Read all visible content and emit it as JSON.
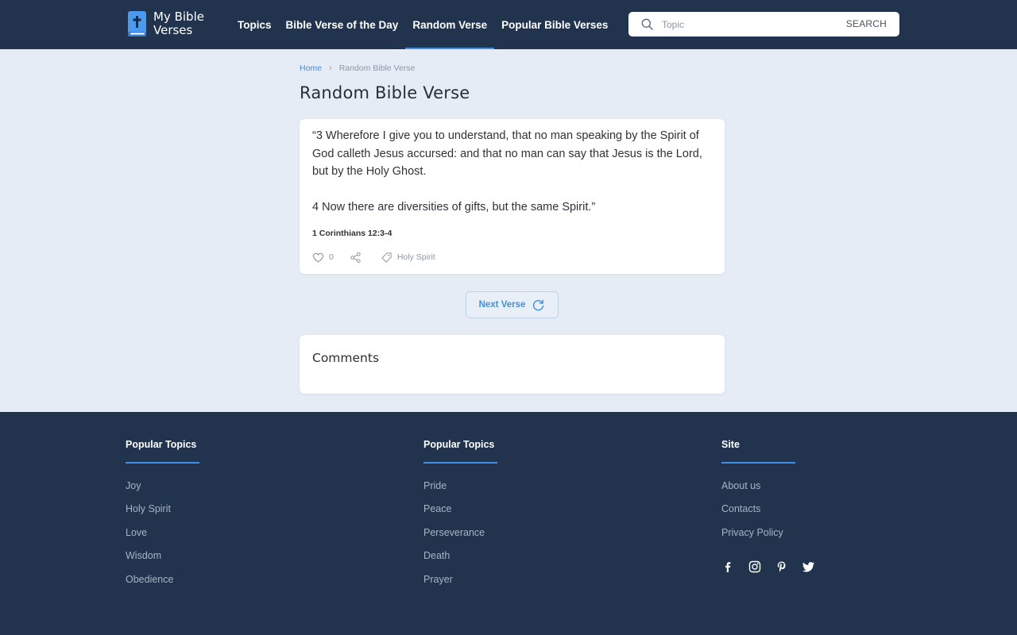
{
  "header": {
    "logo_line1": "My Bible",
    "logo_line2": "Verses",
    "nav": [
      {
        "label": "Topics",
        "active": false
      },
      {
        "label": "Bible Verse of the Day",
        "active": false
      },
      {
        "label": "Random Verse",
        "active": true
      },
      {
        "label": "Popular Bible Verses",
        "active": false
      }
    ],
    "search": {
      "placeholder": "Topic",
      "value": "",
      "button_label": "SEARCH"
    }
  },
  "breadcrumb": {
    "home": "Home",
    "separator": "›",
    "current": "Random Bible Verse"
  },
  "page_title": "Random Bible Verse",
  "verse": {
    "paragraph1": "“3 Wherefore I give you to understand, that no man speaking by the Spirit of God calleth Jesus accursed: and that no man can say that Jesus is the Lord, but by the Holy Ghost.",
    "paragraph2": "4 Now there are diversities of gifts, but the same Spirit.”",
    "reference": "1 Corinthians 12:3-4",
    "likes": "0",
    "tag": "Holy Spirit"
  },
  "next_verse_label": "Next Verse",
  "comments_title": "Comments",
  "footer": {
    "columns": [
      {
        "title": "Popular Topics",
        "links": [
          "Joy",
          "Holy Spirit",
          "Love",
          "Wisdom",
          "Obedience"
        ]
      },
      {
        "title": "Popular Topics",
        "links": [
          "Pride",
          "Peace",
          "Perseverance",
          "Death",
          "Prayer"
        ]
      },
      {
        "title": "Site",
        "links": [
          "About us",
          "Contacts",
          "Privacy Policy"
        ]
      }
    ],
    "social": [
      "facebook-icon",
      "instagram-icon",
      "pinterest-icon",
      "twitter-icon"
    ]
  },
  "colors": {
    "header_bg": "#22344d",
    "page_bg": "#e5ecf5",
    "accent": "#3f8fe6",
    "footer_link": "#a7b3c3"
  }
}
